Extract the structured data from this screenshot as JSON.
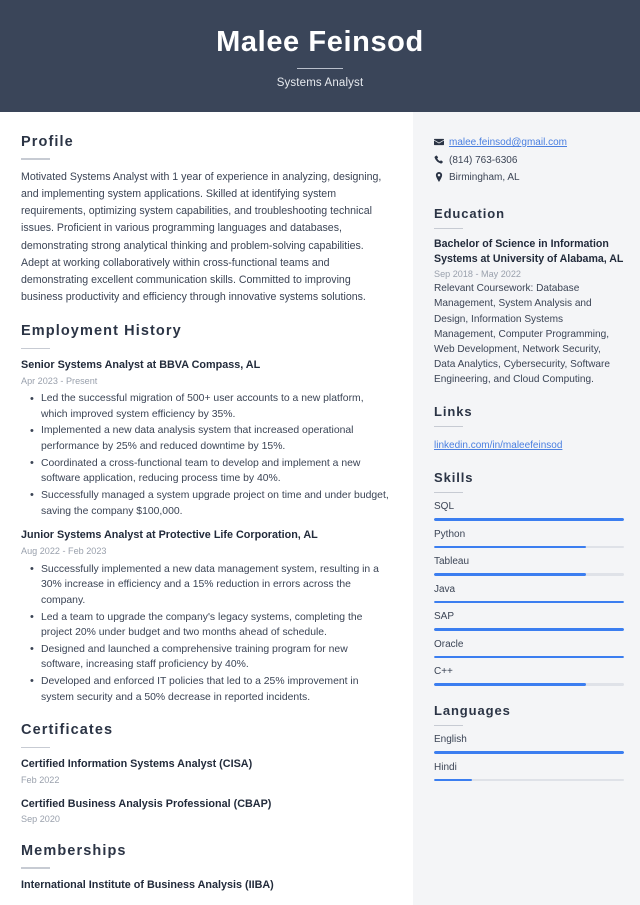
{
  "header": {
    "name": "Malee Feinsod",
    "job_title": "Systems Analyst"
  },
  "main": {
    "profile": {
      "heading": "Profile",
      "text": "Motivated Systems Analyst with 1 year of experience in analyzing, designing, and implementing system applications. Skilled at identifying system requirements, optimizing system capabilities, and troubleshooting technical issues. Proficient in various programming languages and databases, demonstrating strong analytical thinking and problem-solving capabilities. Adept at working collaboratively within cross-functional teams and demonstrating excellent communication skills. Committed to improving business productivity and efficiency through innovative systems solutions."
    },
    "employment": {
      "heading": "Employment History",
      "jobs": [
        {
          "title": "Senior Systems Analyst at BBVA Compass, AL",
          "date": "Apr 2023 - Present",
          "bullets": [
            "Led the successful migration of 500+ user accounts to a new platform, which improved system efficiency by 35%.",
            "Implemented a new data analysis system that increased operational performance by 25% and reduced downtime by 15%.",
            "Coordinated a cross-functional team to develop and implement a new software application, reducing process time by 40%.",
            "Successfully managed a system upgrade project on time and under budget, saving the company $100,000."
          ]
        },
        {
          "title": "Junior Systems Analyst at Protective Life Corporation, AL",
          "date": "Aug 2022 - Feb 2023",
          "bullets": [
            "Successfully implemented a new data management system, resulting in a 30% increase in efficiency and a 15% reduction in errors across the company.",
            "Led a team to upgrade the company's legacy systems, completing the project 20% under budget and two months ahead of schedule.",
            "Designed and launched a comprehensive training program for new software, increasing staff proficiency by 40%.",
            "Developed and enforced IT policies that led to a 25% improvement in system security and a 50% decrease in reported incidents."
          ]
        }
      ]
    },
    "certificates": {
      "heading": "Certificates",
      "items": [
        {
          "title": "Certified Information Systems Analyst (CISA)",
          "date": "Feb 2022"
        },
        {
          "title": "Certified Business Analysis Professional (CBAP)",
          "date": "Sep 2020"
        }
      ]
    },
    "memberships": {
      "heading": "Memberships",
      "items": [
        {
          "title": "International Institute of Business Analysis (IIBA)"
        }
      ]
    }
  },
  "sidebar": {
    "contact": [
      {
        "icon": "envelope-icon",
        "text": "malee.feinsod@gmail.com",
        "is_link": true
      },
      {
        "icon": "phone-icon",
        "text": "(814) 763-6306",
        "is_link": false
      },
      {
        "icon": "location-pin-icon",
        "text": "Birmingham, AL",
        "is_link": false
      }
    ],
    "education": {
      "heading": "Education",
      "degree": "Bachelor of Science in Information Systems at University of Alabama, AL",
      "date": "Sep 2018 - May 2022",
      "description": "Relevant Coursework: Database Management, System Analysis and Design, Information Systems Management, Computer Programming, Web Development, Network Security, Data Analytics, Cybersecurity, Software Engineering, and Cloud Computing."
    },
    "links": {
      "heading": "Links",
      "items": [
        {
          "label": "linkedin.com/in/maleefeinsod"
        }
      ]
    },
    "skills": {
      "heading": "Skills",
      "items": [
        {
          "label": "SQL",
          "level": 100
        },
        {
          "label": "Python",
          "level": 80
        },
        {
          "label": "Tableau",
          "level": 80
        },
        {
          "label": "Java",
          "level": 100
        },
        {
          "label": "SAP",
          "level": 100
        },
        {
          "label": "Oracle",
          "level": 100
        },
        {
          "label": "C++",
          "level": 80
        }
      ]
    },
    "languages": {
      "heading": "Languages",
      "items": [
        {
          "label": "English",
          "level": 100
        },
        {
          "label": "Hindi",
          "level": 20
        }
      ]
    }
  },
  "colors": {
    "header_bg": "#3a4559",
    "sidebar_bg": "#f4f5f7",
    "accent_blue": "#3b7ef0",
    "link_blue": "#4a7fe0",
    "text_dark": "#2b3445",
    "muted": "#9aa1ad"
  }
}
